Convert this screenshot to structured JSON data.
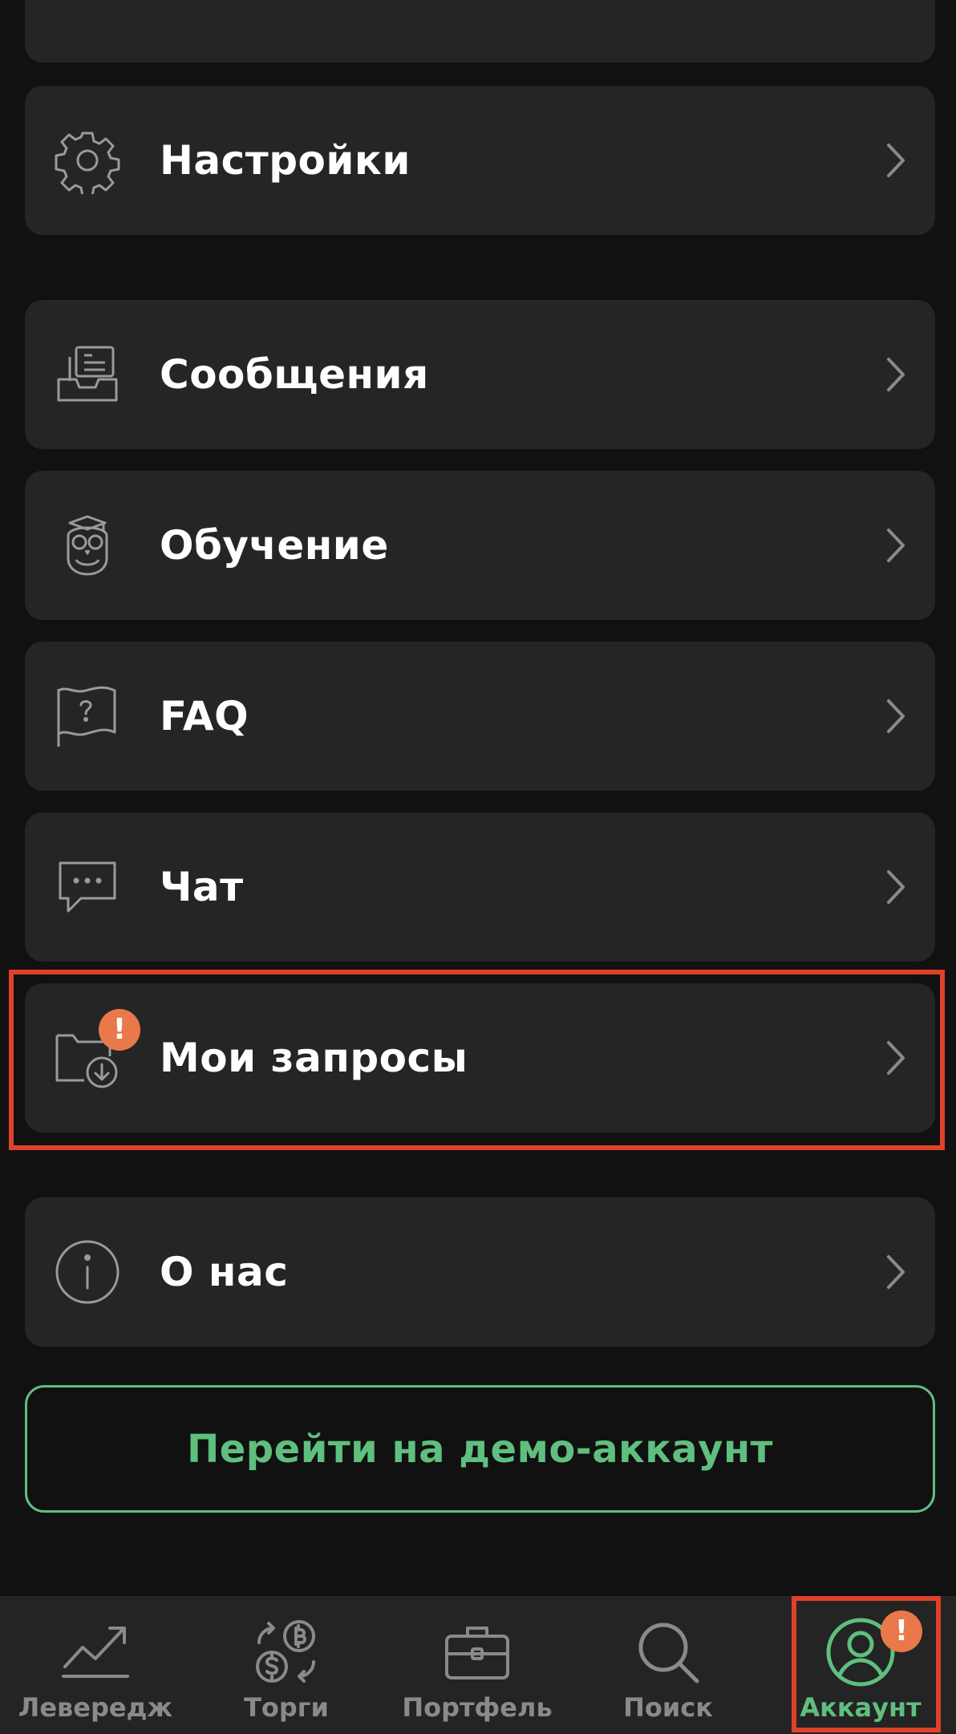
{
  "menu": {
    "items": [
      {
        "label": "Настройки",
        "icon": "gear-icon"
      },
      {
        "label": "Сообщения",
        "icon": "inbox-icon"
      },
      {
        "label": "Обучение",
        "icon": "owl-icon"
      },
      {
        "label": "FAQ",
        "icon": "faq-flag-icon"
      },
      {
        "label": "Чат",
        "icon": "chat-icon"
      },
      {
        "label": "Мои запросы",
        "icon": "folder-download-icon",
        "badge": "!"
      },
      {
        "label": "О нас",
        "icon": "info-icon"
      }
    ]
  },
  "demo_button": {
    "label": "Перейти на демо-аккаунт"
  },
  "tabbar": {
    "tabs": [
      {
        "label": "Левередж",
        "icon": "leverage-chart-icon"
      },
      {
        "label": "Торги",
        "icon": "trade-exchange-icon"
      },
      {
        "label": "Портфель",
        "icon": "briefcase-icon"
      },
      {
        "label": "Поиск",
        "icon": "search-icon"
      },
      {
        "label": "Аккаунт",
        "icon": "account-icon",
        "active": true,
        "badge": "!"
      }
    ]
  },
  "colors": {
    "background": "#111111",
    "card": "#252525",
    "accent_green": "#5fbf7f",
    "badge_orange": "#e9784a",
    "highlight_red": "#e0412a",
    "muted": "#8a8a8a"
  }
}
